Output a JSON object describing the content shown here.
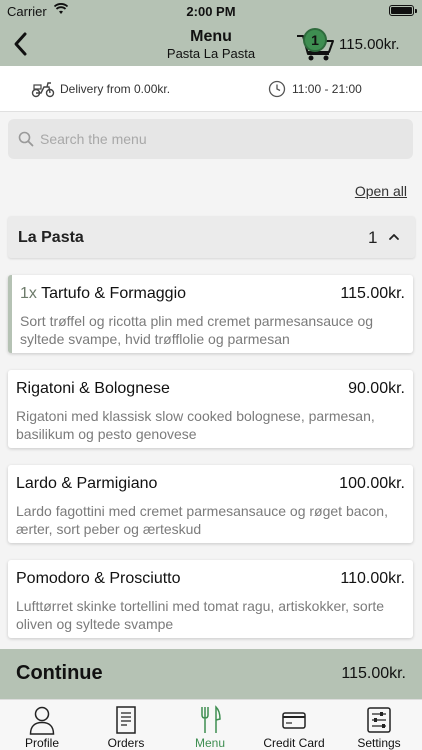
{
  "status_bar": {
    "carrier": "Carrier",
    "time": "2:00 PM"
  },
  "nav": {
    "title": "Menu",
    "subtitle": "Pasta La Pasta",
    "cart_count": "1",
    "cart_total": "115.00kr."
  },
  "info": {
    "delivery": "Delivery from 0.00kr.",
    "hours": "11:00 - 21:00"
  },
  "search": {
    "placeholder": "Search the menu"
  },
  "open_all": "Open all",
  "category": {
    "name": "La Pasta",
    "count": "1"
  },
  "items": [
    {
      "qty": "1x",
      "name": "Tartufo & Formaggio",
      "price": "115.00kr.",
      "desc": "Sort trøffel og ricotta plin med cremet parmesansauce og syltede svampe, hvid trøfflolie og parmesan"
    },
    {
      "qty": "",
      "name": "Rigatoni & Bolognese",
      "price": "90.00kr.",
      "desc": "Rigatoni med klassisk slow cooked bolognese, parmesan, basilikum og pesto genovese"
    },
    {
      "qty": "",
      "name": "Lardo & Parmigiano",
      "price": "100.00kr.",
      "desc": "Lardo fagottini med cremet parmesansauce og røget bacon, ærter, sort peber og ærteskud"
    },
    {
      "qty": "",
      "name": "Pomodoro & Prosciutto",
      "price": "110.00kr.",
      "desc": "Lufttørret skinke tortellini med tomat ragu, artiskokker, sorte oliven og syltede svampe"
    }
  ],
  "continue": {
    "label": "Continue",
    "total": "115.00kr."
  },
  "tabs": [
    {
      "label": "Profile",
      "icon": "person-icon"
    },
    {
      "label": "Orders",
      "icon": "receipt-icon"
    },
    {
      "label": "Menu",
      "icon": "fork-knife-icon"
    },
    {
      "label": "Credit Card",
      "icon": "credit-card-icon"
    },
    {
      "label": "Settings",
      "icon": "sliders-icon"
    }
  ],
  "colors": {
    "accent": "#b5c2b4",
    "green": "#3e8e51"
  }
}
